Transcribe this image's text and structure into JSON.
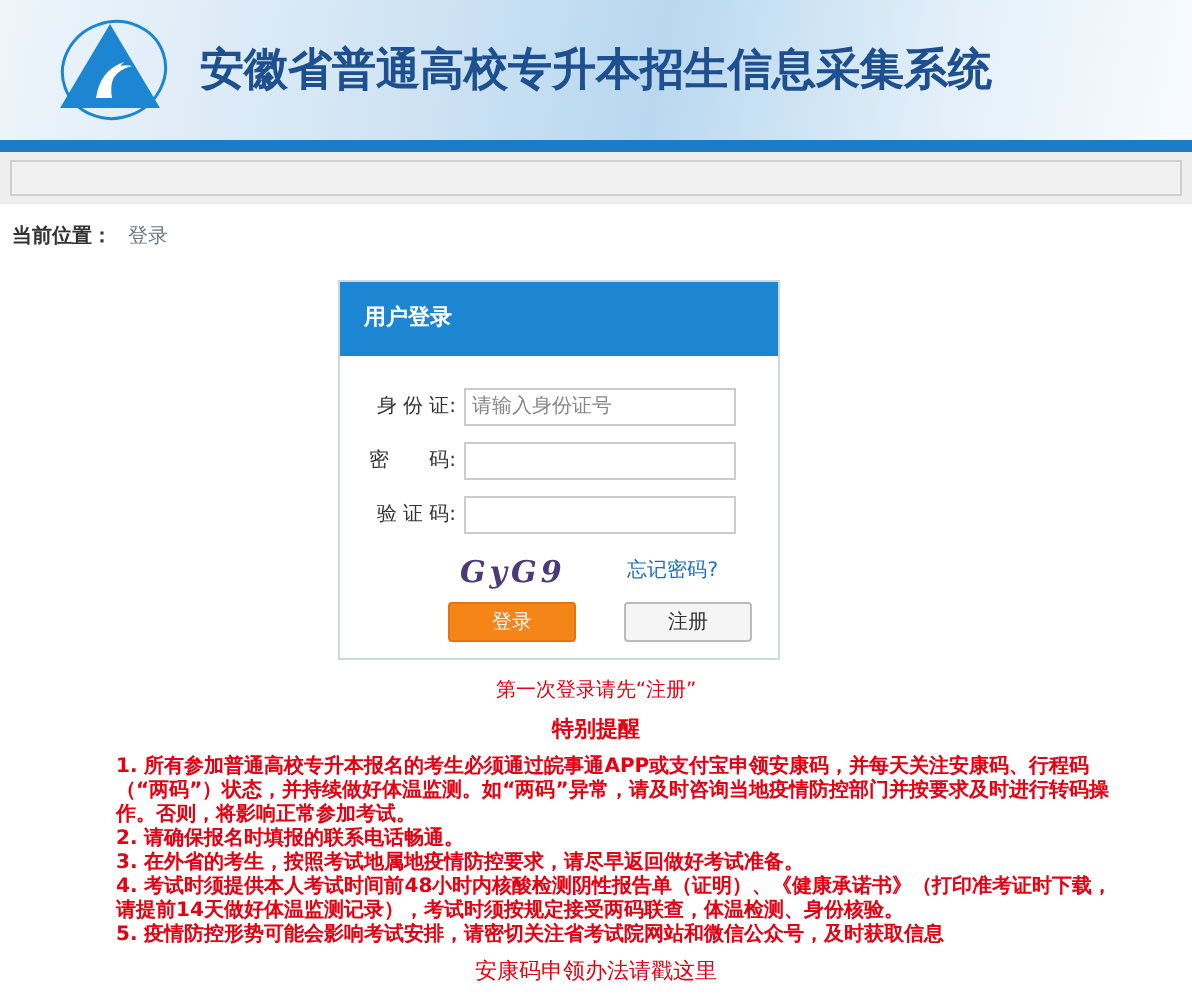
{
  "header": {
    "title": "安徽省普通高校专升本招生信息采集系统"
  },
  "breadcrumb": {
    "label": "当前位置：",
    "current": "登录"
  },
  "login": {
    "title": "用户登录",
    "fields": [
      {
        "label": "身 份 证:",
        "placeholder": "请输入身份证号"
      },
      {
        "label": "密　　码:"
      },
      {
        "label": "验 证 码:"
      }
    ],
    "captcha": "GyG9",
    "forgot": "忘记密码?",
    "buttons": [
      {
        "label": "登录",
        "kind": "primary"
      },
      {
        "label": "注册",
        "kind": "secondary"
      }
    ]
  },
  "first_login": "第一次登录请先“注册”",
  "notice_title": "特别提醒",
  "notices": [
    "1. 所有参加普通高校专升本报名的考生必须通过皖事通APP或支付宝申领安康码，并每天关注安康码、行程码（“两码”）状态，并持续做好体温监测。如“两码”异常，请及时咨询当地疫情防控部门并按要求及时进行转码操作。否则，将影响正常参加考试。",
    "2. 请确保报名时填报的联系电话畅通。",
    "3. 在外省的考生，按照考试地属地疫情防控要求，请尽早返回做好考试准备。",
    "4. 考试时须提供本人考试时间前48小时内核酸检测阴性报告单（证明）、《健康承诺书》（打印准考证时下载，请提前14天做好体温监测记录），考试时须按规定接受两码联查，体温检测、身份核验。",
    "5. 疫情防控形势可能会影响考试安排，请密切关注省考试院网站和微信公众号，及时获取信息"
  ],
  "guide_link": "安康码申领办法请戳这里"
}
